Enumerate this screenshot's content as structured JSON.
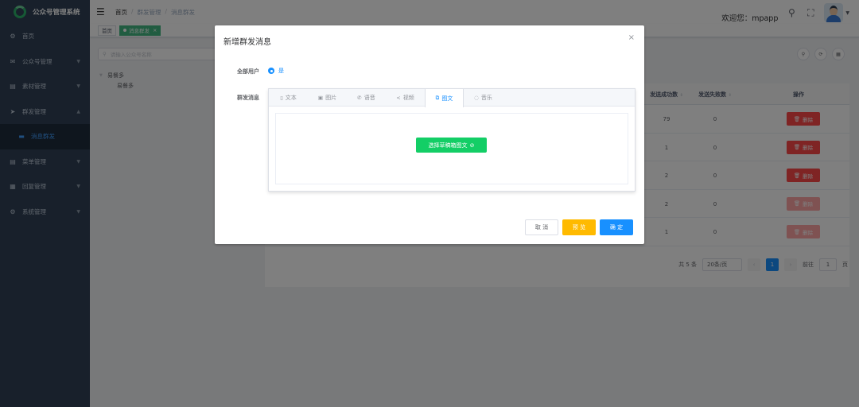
{
  "app": {
    "title": "公众号管理系统"
  },
  "colors": {
    "sidebar": "#304156",
    "accent": "#1890ff",
    "success": "#13ce66",
    "danger": "#ff4949",
    "warning": "#ffba00"
  },
  "sidebar": {
    "items": [
      {
        "label": "首页",
        "icon": "dashboard-icon",
        "glyph": "⚙"
      },
      {
        "label": "公众号管理",
        "icon": "wechat-icon",
        "glyph": "✉"
      },
      {
        "label": "素材管理",
        "icon": "material-icon",
        "glyph": "▤"
      },
      {
        "label": "群发管理",
        "icon": "send-icon",
        "glyph": "➤"
      },
      {
        "label": "消息群发",
        "icon": "message-icon",
        "glyph": "▬"
      },
      {
        "label": "菜单管理",
        "icon": "menu-icon",
        "glyph": "▤"
      },
      {
        "label": "回复管理",
        "icon": "reply-icon",
        "glyph": "▦"
      },
      {
        "label": "系统管理",
        "icon": "system-icon",
        "glyph": "⚙"
      }
    ]
  },
  "navbar": {
    "breadcrumb": [
      "首页",
      "群发管理",
      "消息群发"
    ],
    "welcome": "欢迎您：mpapp"
  },
  "tags": {
    "home": "首页",
    "active": "消息群发"
  },
  "main": {
    "search_placeholder": "请输入公众号名称",
    "tree": {
      "parent": "易餐多",
      "child": "易餐多"
    },
    "table": {
      "headers": {
        "success": "发送成功数",
        "fail": "发送失败数",
        "op": "操作"
      },
      "rows": [
        {
          "success": "79",
          "fail": "0"
        },
        {
          "success": "1",
          "fail": "0"
        },
        {
          "success": "2",
          "fail": "0"
        },
        {
          "success": "2",
          "fail": "0"
        },
        {
          "success": "1",
          "fail": "0"
        }
      ],
      "delete_label": "删除"
    },
    "pagination": {
      "total": "共 5 条",
      "page_size": "20条/页",
      "current": "1",
      "goto_prefix": "前往",
      "goto_value": "1",
      "goto_suffix": "页"
    }
  },
  "dialog": {
    "title": "新增群发消息",
    "all_users_label": "全部用户",
    "all_users_value": "是",
    "message_label": "群发消息",
    "tabs": [
      {
        "label": "文本",
        "icon": "document-icon"
      },
      {
        "label": "图片",
        "icon": "picture-icon"
      },
      {
        "label": "语音",
        "icon": "phone-icon"
      },
      {
        "label": "视频",
        "icon": "share-icon"
      },
      {
        "label": "图文",
        "icon": "news-icon"
      },
      {
        "label": "音乐",
        "icon": "music-icon"
      }
    ],
    "active_tab": "图文",
    "pick_button": "选择草稿箱图文",
    "buttons": {
      "cancel": "取 消",
      "preview": "预 览",
      "ok": "确 定"
    }
  }
}
